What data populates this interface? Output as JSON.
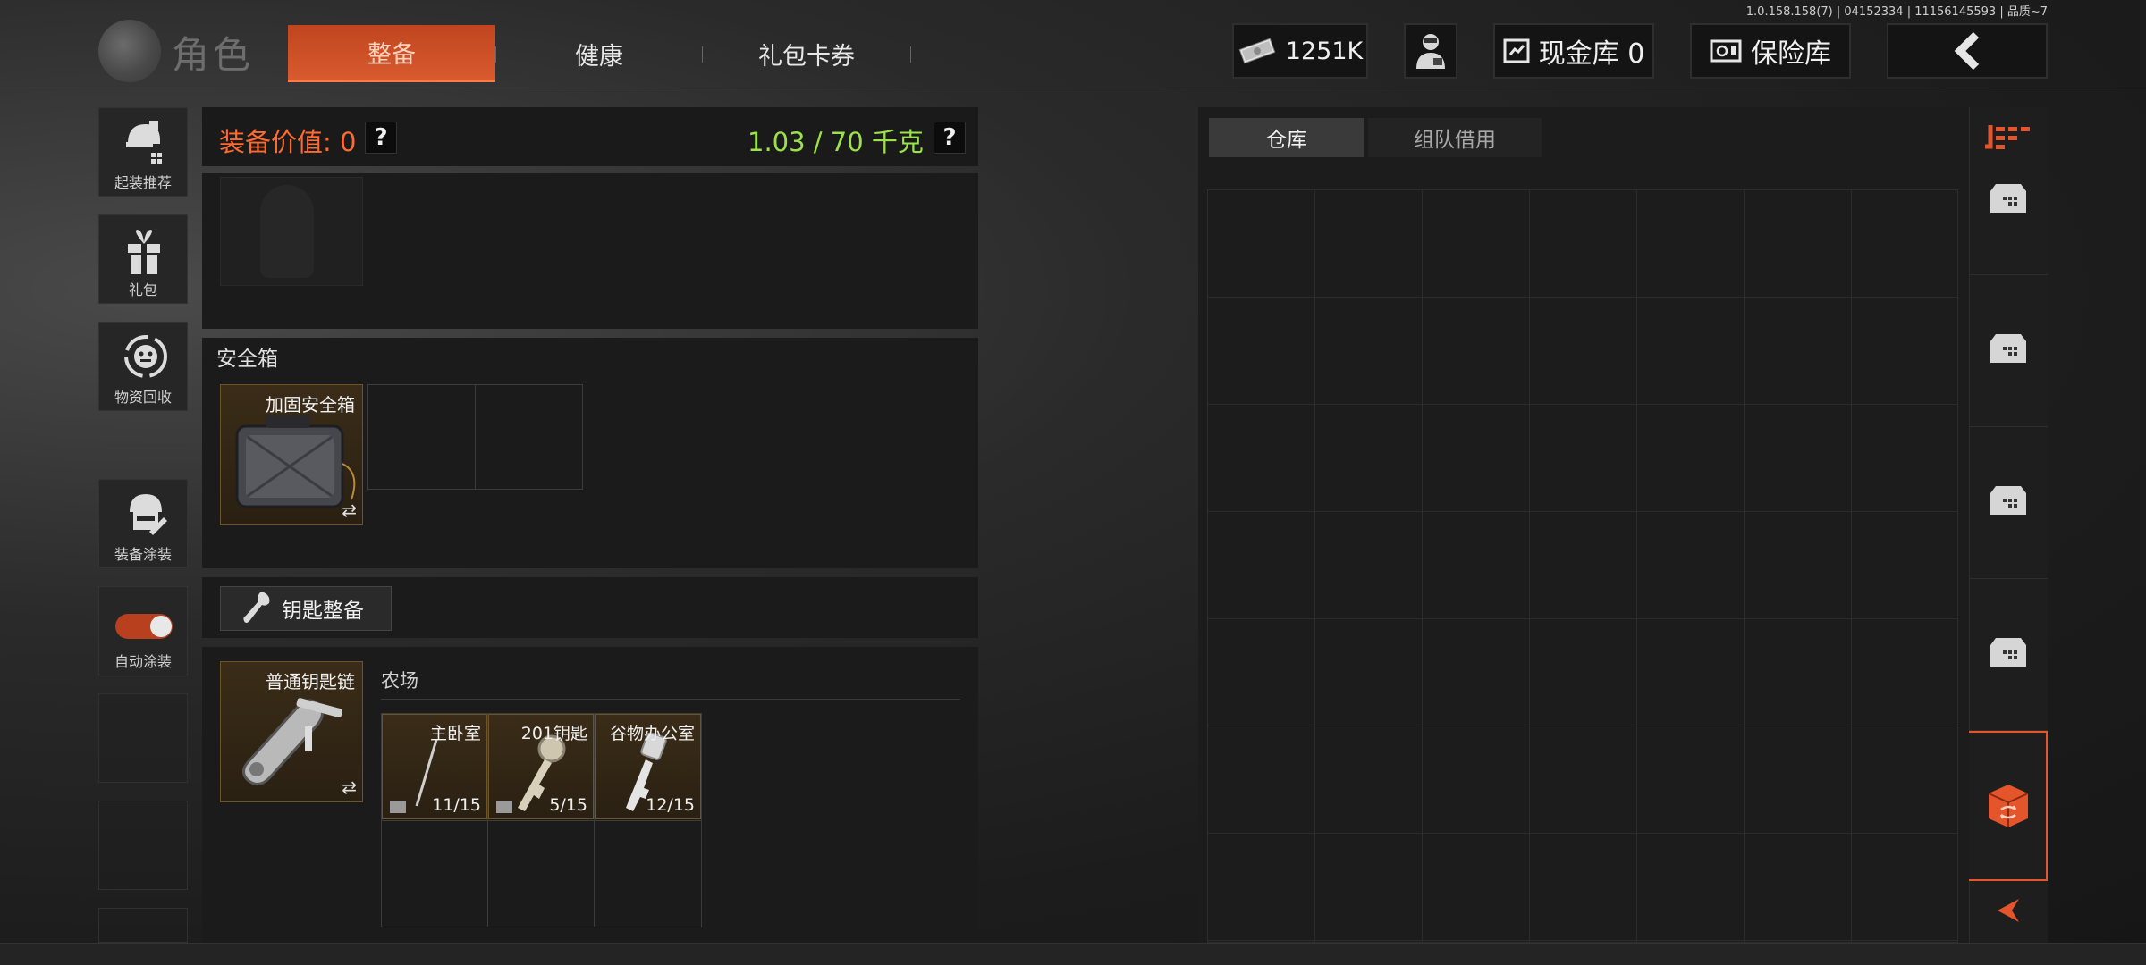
{
  "version_text": "1.0.158.158(7) | 04152334 | 11156145593 | 品质~7",
  "header": {
    "title": "角色",
    "tabs": [
      {
        "label": "整备",
        "active": true
      },
      {
        "label": "健康",
        "active": false
      },
      {
        "label": "礼包卡券",
        "active": false
      }
    ],
    "cash_value": "1251K",
    "cash_vault_label": "现金库 0",
    "safe_vault_label": "保险库"
  },
  "sidebar": {
    "items": [
      {
        "label": "起装推荐",
        "icon": "helmet-recommend-icon"
      },
      {
        "label": "礼包",
        "icon": "gift-icon"
      },
      {
        "label": "物资回收",
        "icon": "recycle-icon"
      },
      {
        "label": "装备涂装",
        "icon": "soldier-skin-icon"
      },
      {
        "label": "自动涂装",
        "icon": "toggle-switch",
        "toggle_on": true
      }
    ]
  },
  "loadout": {
    "equip_value_label": "装备价值: 0",
    "help_symbol": "?",
    "weight_label": "1.03 / 70 千克",
    "safebox_section_title": "安全箱",
    "safebox_item_name": "加固安全箱",
    "swap_symbol": "⇄",
    "key_loadout_button": "钥匙整备",
    "keychain_item_name": "普通钥匙链",
    "key_region_title": "农场",
    "keys": [
      {
        "name": "主卧室",
        "count": "11/15"
      },
      {
        "name": "201钥匙",
        "count": "5/15"
      },
      {
        "name": "谷物办公室",
        "count": "12/15"
      }
    ]
  },
  "warehouse": {
    "tabs": [
      {
        "label": "仓库",
        "active": true
      },
      {
        "label": "组队借用",
        "active": false
      }
    ]
  },
  "colors": {
    "accent_orange": "#ff6a2e",
    "tab_active": "#c0451f",
    "weight_green": "#9be24a",
    "rail_active": "#e5552b"
  }
}
